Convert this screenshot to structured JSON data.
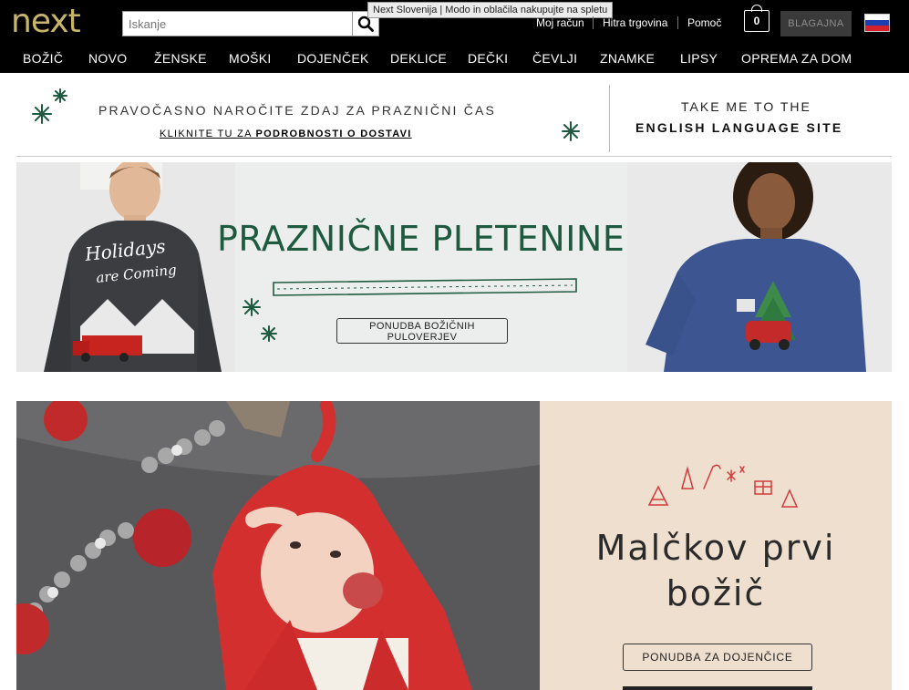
{
  "header": {
    "logo_text": "next",
    "search_placeholder": "Iskanje",
    "tooltip": "Next Slovenija | Modo in oblačila nakupujte na spletu",
    "links": [
      "Moj račun",
      "Hitra trgovina",
      "Pomoč"
    ],
    "bag_count": "0",
    "checkout_label": "BLAGAJNA",
    "flag": "slovenia-flag"
  },
  "nav": {
    "items": [
      "BOŽIČ",
      "NOVO",
      "ŽENSKE",
      "MOŠKI",
      "DOJENČEK",
      "DEKLICE",
      "DEČKI",
      "ČEVLJI",
      "ZNAMKE",
      "LIPSY",
      "OPREMA ZA DOM"
    ]
  },
  "promo": {
    "line1": "PRAVOČASNO NAROČITE ZDAJ ZA PRAZNIČNI ČAS",
    "line2_prefix": "KLIKNITE TU ZA ",
    "line2_bold": "PODROBNOSTI O DOSTAVI",
    "english_line1": "TAKE ME TO THE",
    "english_line2": "ENGLISH LANGUAGE SITE"
  },
  "banner_knitwear": {
    "title": "PRAZNIČNE PLETENINE",
    "button_line1": "PONUDBA BOŽIČNIH",
    "button_line2": "PULOVERJEV",
    "sweater_text1": "Holidays",
    "sweater_text2": "are Coming"
  },
  "banner_baby": {
    "title_line1": "Malčkov prvi",
    "title_line2": "božič",
    "button_label": "PONUDBA ZA DOJENČICE"
  },
  "colors": {
    "accent_gold": "#c9b56a",
    "christmas_green": "#1e5a3f",
    "panel_beige": "#eedfcf",
    "festive_red": "#d23b3b"
  }
}
